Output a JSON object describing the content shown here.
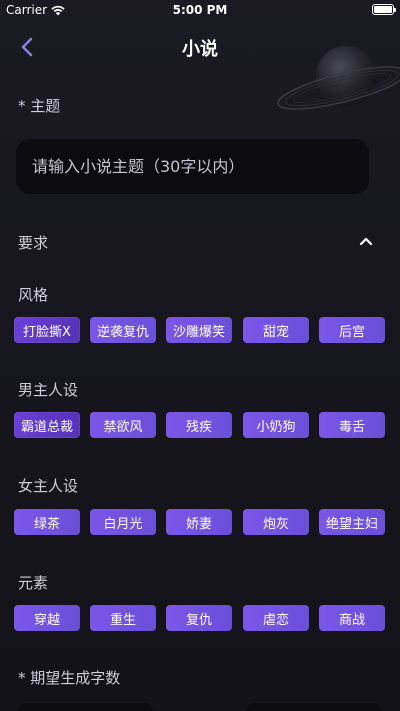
{
  "status_bar": {
    "carrier": "Carrier",
    "time": "5:00 PM"
  },
  "nav": {
    "title": "小说",
    "back_icon": "chevron-left-icon"
  },
  "topic": {
    "label": "* 主题",
    "placeholder": "请输入小说主题（30字以内）"
  },
  "requirements": {
    "label": "要求",
    "toggle_icon": "chevron-up-icon"
  },
  "groups": [
    {
      "label": "风格",
      "tags": [
        "打脸撕X",
        "逆袭复仇",
        "沙雕爆笑",
        "甜宠",
        "后宫"
      ]
    },
    {
      "label": "男主人设",
      "tags": [
        "霸道总裁",
        "禁欲风",
        "残疾",
        "小奶狗",
        "毒舌"
      ]
    },
    {
      "label": "女主人设",
      "tags": [
        "绿茶",
        "白月光",
        "娇妻",
        "炮灰",
        "绝望主妇"
      ]
    },
    {
      "label": "元素",
      "tags": [
        "穿越",
        "重生",
        "复仇",
        "虐恋",
        "商战"
      ]
    }
  ],
  "word_count": {
    "label": "* 期望生成字数"
  },
  "colors": {
    "accent": "#7b56e8",
    "background": "#16151d",
    "input_bg": "#0b0b10"
  }
}
